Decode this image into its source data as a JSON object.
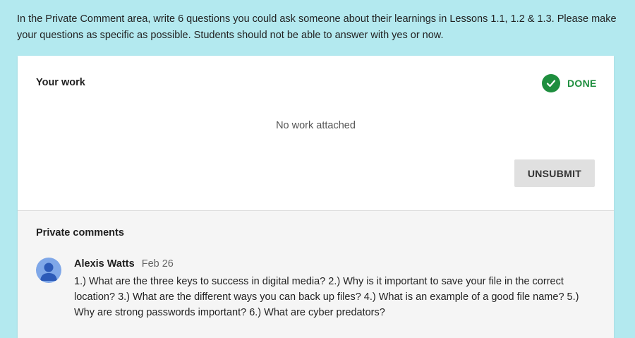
{
  "instructions": "In the Private Comment area, write 6 questions you could ask someone about their learnings in Lessons 1.1, 1.2 & 1.3. Please make your questions as specific as possible. Students should not be able to answer with yes or now.",
  "work": {
    "title": "Your work",
    "status": "DONE",
    "status_icon": "check-circle-icon",
    "empty_text": "No work attached",
    "unsubmit_label": "UNSUBMIT"
  },
  "comments": {
    "title": "Private comments",
    "items": [
      {
        "author": "Alexis Watts",
        "date": "Feb 26",
        "text": "1.) What are the three keys to success in digital media? 2.) Why is it important to save your file in the correct location? 3.) What are the different ways you can back up files? 4.) What is an example of a good file name? 5.) Why are strong passwords important? 6.) What are cyber predators?"
      }
    ]
  },
  "colors": {
    "page_background": "#b3e9ef",
    "done_green": "#1e8e3e",
    "avatar_blue": "#7fa7e8",
    "button_gray": "#e0e0e0"
  }
}
